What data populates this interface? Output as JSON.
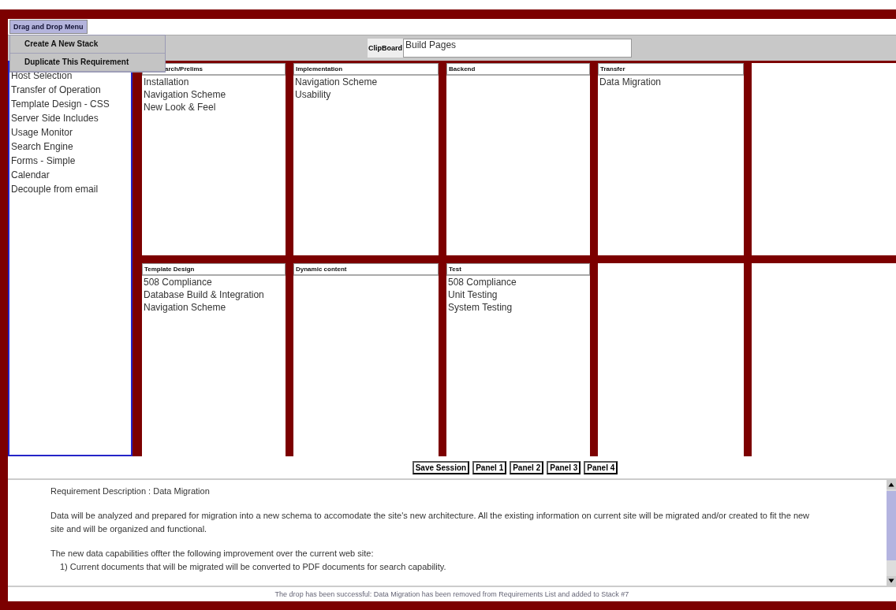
{
  "menu": {
    "label": "Drag and Drop Menu",
    "expanded": true,
    "items": [
      "Create A New Stack",
      "Duplicate This Requirement"
    ]
  },
  "clipboard": {
    "label": "ClipBoard",
    "value": "Build Pages"
  },
  "requirements": [
    "Host Selection",
    "Transfer of Operation",
    "Template Design - CSS",
    "Server Side Includes",
    "Usage Monitor",
    "Search Engine",
    "Forms - Simple",
    "Calendar",
    "Decouple from email"
  ],
  "stacks": [
    {
      "kind": "stack",
      "header": "arch/Prelims",
      "items": [
        "Installation",
        "Navigation Scheme",
        "New Look & Feel"
      ]
    },
    {
      "kind": "stack",
      "header": "Implementation",
      "items": [
        "Navigation Scheme",
        "Usability"
      ]
    },
    {
      "kind": "stack",
      "header": "Backend"
    },
    {
      "kind": "stack",
      "header": "Transfer",
      "items": [
        "Data Migration"
      ]
    },
    {
      "kind": "empty"
    },
    {
      "kind": "stack",
      "header": "Template Design",
      "items": [
        "508 Compliance",
        "Database Build & Integration",
        "Navigation Scheme"
      ]
    },
    {
      "kind": "stack",
      "header": "Dynamic content"
    },
    {
      "kind": "stack",
      "header": "Test",
      "items": [
        "508 Compliance",
        "Unit Testing",
        "System Testing"
      ]
    },
    {
      "kind": "empty"
    },
    {
      "kind": "empty"
    }
  ],
  "buttons": [
    "Save Session",
    "Panel 1",
    "Panel 2",
    "Panel 3",
    "Panel 4"
  ],
  "description": [
    "Requirement Description : Data Migration",
    "Data will be analyzed and prepared for migration into a new schema to accomodate the site's new architecture. All the existing information on current site will be migrated and/or created to fit the new site and will be organized and functional.",
    "The new data capabilities offter the following improvement over the current web site:",
    "1) Current documents that will be migrated will be converted to PDF documents for search capability."
  ],
  "status": "The drop has been successful: Data Migration has been removed from Requirements List and added to Stack #7"
}
